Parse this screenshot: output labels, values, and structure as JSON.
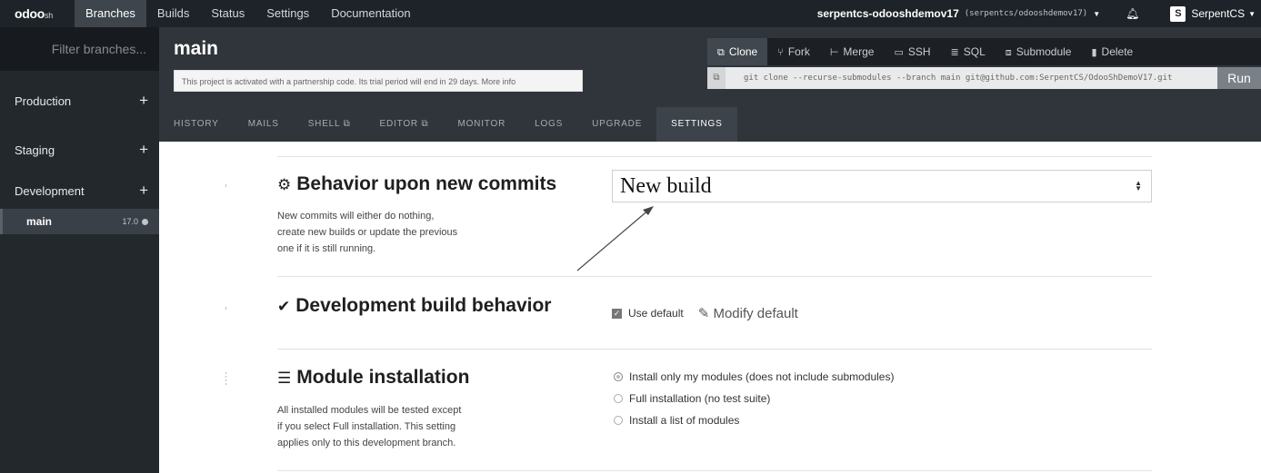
{
  "topnav": {
    "logo": "odoo",
    "logo_suffix": "sh",
    "items": [
      {
        "label": "Branches",
        "active": true
      },
      {
        "label": "Builds",
        "active": false
      },
      {
        "label": "Status",
        "active": false
      },
      {
        "label": "Settings",
        "active": false
      },
      {
        "label": "Documentation",
        "active": false
      }
    ],
    "project_name": "serpentcs-odooshdemov17",
    "project_repo": "(serpentcs/odooshdemov17)",
    "user_initial": "S",
    "user_name": "SerpentCS"
  },
  "sidebar": {
    "filter_placeholder": "Filter branches...",
    "stages": [
      "Production",
      "Staging",
      "Development"
    ],
    "branch": {
      "name": "main",
      "version": "17.0"
    }
  },
  "header": {
    "branch_title": "main",
    "notice": "This project is activated with a partnership code. Its trial period will end in 29 days. More info",
    "actions": [
      {
        "icon": "clone-icon",
        "glyph": "⧉",
        "label": "Clone",
        "active": true
      },
      {
        "icon": "fork-icon",
        "glyph": "⑂",
        "label": "Fork",
        "active": false
      },
      {
        "icon": "merge-icon",
        "glyph": "⊢",
        "label": "Merge",
        "active": false
      },
      {
        "icon": "terminal-icon",
        "glyph": "▭",
        "label": "SSH",
        "active": false
      },
      {
        "icon": "database-icon",
        "glyph": "≣",
        "label": "SQL",
        "active": false
      },
      {
        "icon": "submodule-icon",
        "glyph": "⧈",
        "label": "Submodule",
        "active": false
      },
      {
        "icon": "trash-icon",
        "glyph": "🗑",
        "label": "Delete",
        "active": false
      }
    ],
    "clone_command": "git clone --recurse-submodules --branch main git@github.com:SerpentCS/OdooShDemoV17.git",
    "run_label": "Run",
    "tabs": [
      {
        "label": "HISTORY",
        "active": false
      },
      {
        "label": "MAILS",
        "active": false
      },
      {
        "label": "SHELL ⧉",
        "active": false
      },
      {
        "label": "EDITOR ⧉",
        "active": false
      },
      {
        "label": "MONITOR",
        "active": false
      },
      {
        "label": "LOGS",
        "active": false
      },
      {
        "label": "UPGRADE",
        "active": false
      },
      {
        "label": "SETTINGS",
        "active": true
      }
    ]
  },
  "settings": {
    "commits": {
      "title": "Behavior upon new commits",
      "desc_lines": [
        "New commits will either do nothing,",
        "create new builds or update the previous",
        "one if it is still running."
      ],
      "selected": "New build"
    },
    "devbuild": {
      "title": "Development build behavior",
      "use_default_label": "Use default",
      "modify_label": "Modify default"
    },
    "modules": {
      "title": "Module installation",
      "desc_lines": [
        "All installed modules will be tested except",
        "if you select Full installation. This setting",
        "applies only to this development branch."
      ],
      "options": [
        {
          "label": "Install only my modules (does not include submodules)",
          "selected": true
        },
        {
          "label": "Full installation (no test suite)",
          "selected": false
        },
        {
          "label": "Install a list of modules",
          "selected": false
        }
      ]
    }
  }
}
